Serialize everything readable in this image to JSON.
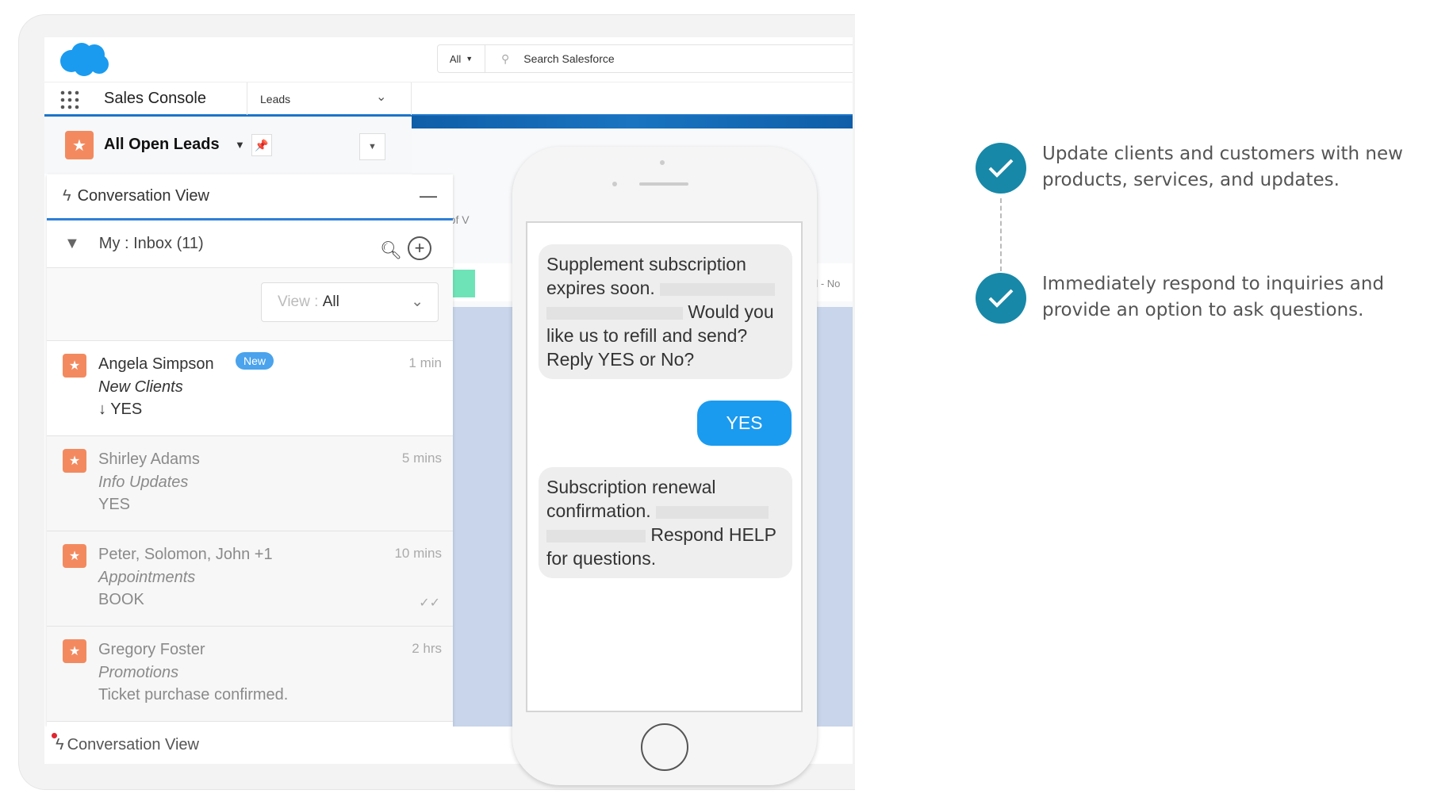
{
  "header": {
    "search_scope": "All",
    "search_placeholder": "Search Salesforce"
  },
  "nav": {
    "app_name": "Sales Console",
    "tab_label": "Leads"
  },
  "list_view": {
    "title": "All Open Leads"
  },
  "background_fragments": {
    "role": "rector of V",
    "status": "d - No"
  },
  "conversation": {
    "title": "Conversation View",
    "inbox_label": "My : Inbox (11)",
    "view_prefix": "View : ",
    "view_value": "All",
    "items": [
      {
        "name": "Angela Simpson",
        "badge": "New",
        "time": "1 min",
        "subject": "New Clients",
        "message": "YES"
      },
      {
        "name": "Shirley Adams",
        "time": "5 mins",
        "subject": "Info Updates",
        "message": "YES"
      },
      {
        "name": "Peter, Solomon, John +1",
        "time": "10 mins",
        "subject": "Appointments",
        "message": "BOOK"
      },
      {
        "name": "Gregory Foster",
        "time": "2 hrs",
        "subject": "Promotions",
        "message": "Ticket purchase confirmed."
      }
    ],
    "footer_label": "Conversation View"
  },
  "phone": {
    "msg1_a": "Supplement subscription expires soon.",
    "msg1_b": "Would you like us to refill and send? Reply YES or No?",
    "reply": "YES",
    "msg2_a": "Subscription renewal confirmation.",
    "msg2_b": "Respond HELP for questions."
  },
  "benefits": [
    {
      "text": "Update clients and customers with new products, services, and updates."
    },
    {
      "text": "Immediately respond to inquiries and provide an option to ask questions."
    }
  ],
  "colors": {
    "brand": "#1a9bf0",
    "accent": "#1b74c8",
    "lead": "#f38a5f",
    "check": "#1788a8"
  }
}
